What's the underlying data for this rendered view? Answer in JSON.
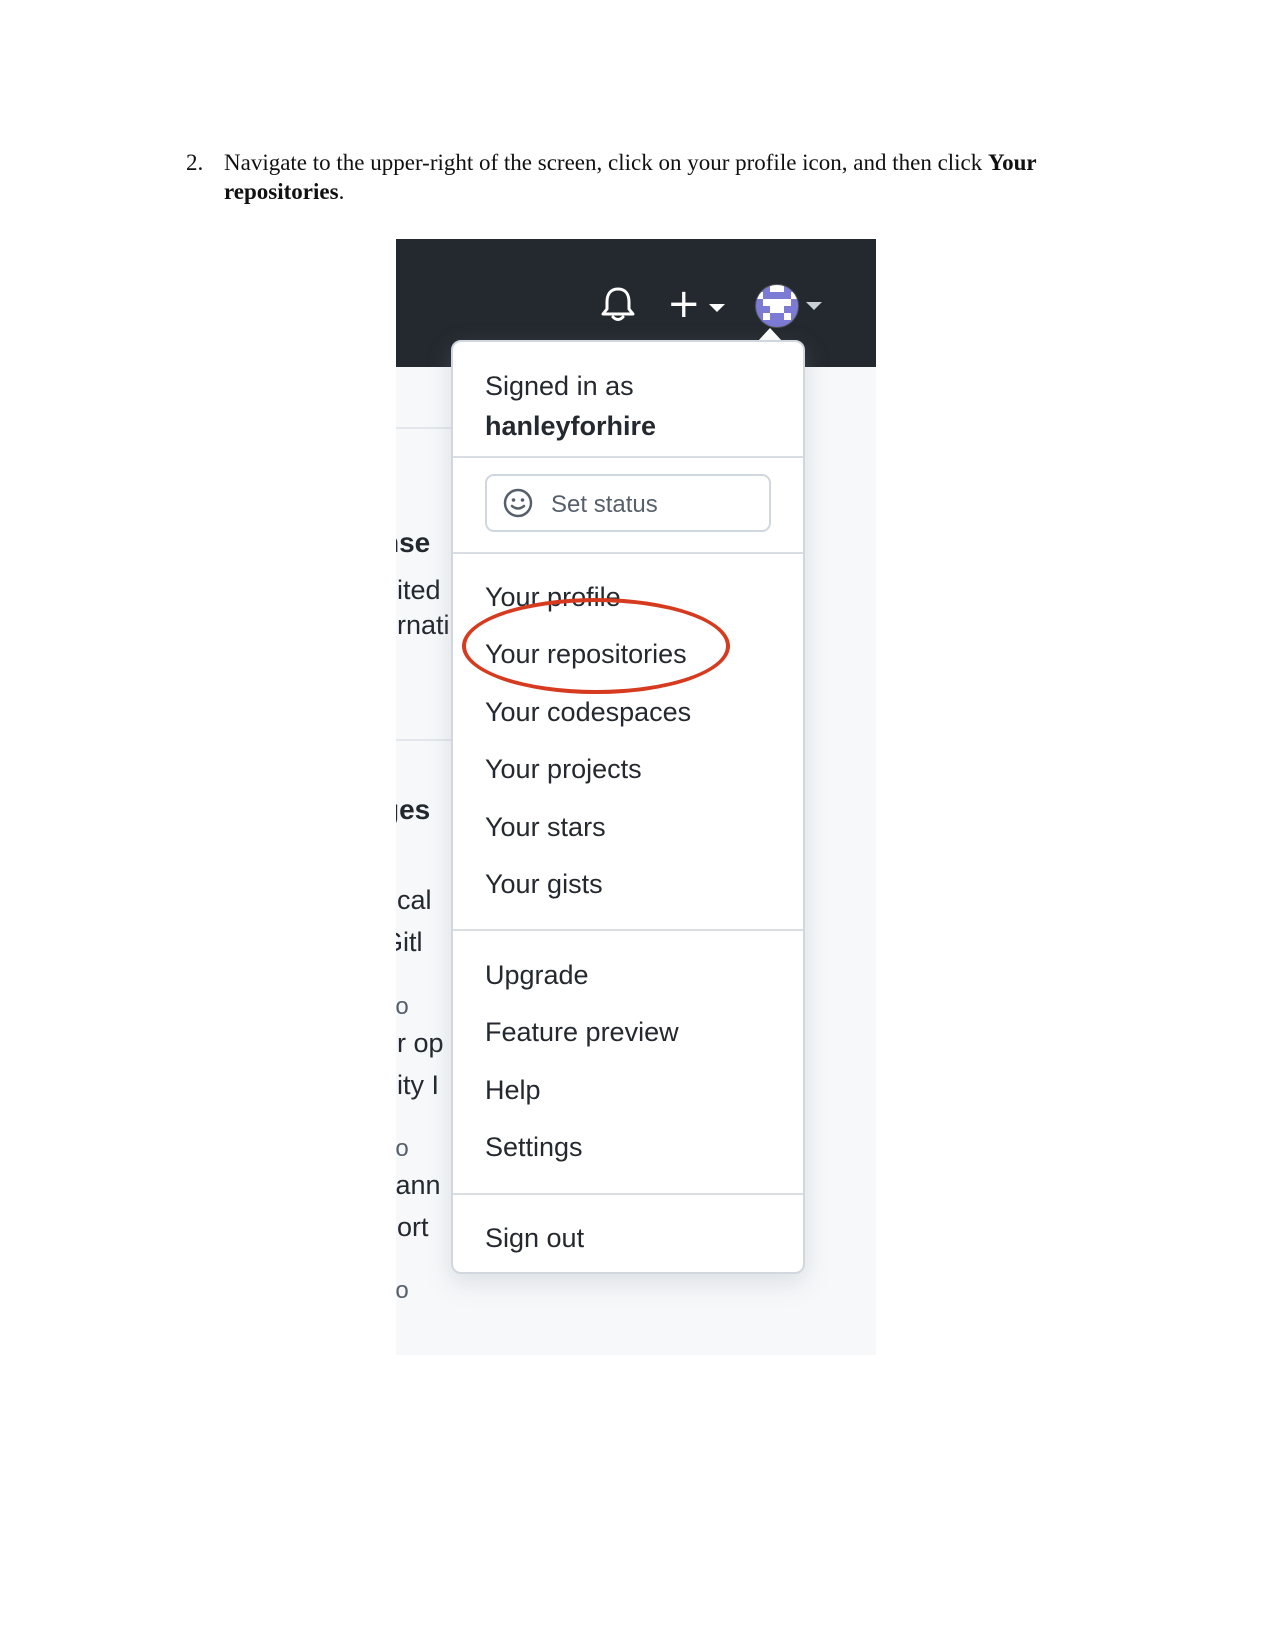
{
  "instruction": {
    "number": "2.",
    "text_before": "Navigate to the upper-right of the screen, click on your profile icon, and then click ",
    "bold_text": "Your repositories",
    "text_after": "."
  },
  "header": {
    "icons": [
      "bell-icon",
      "plus-icon",
      "chevron-down-icon",
      "avatar",
      "chevron-down-icon"
    ]
  },
  "background_fragments": [
    "nse",
    "nited",
    "ernati",
    "ges",
    "o",
    "rical",
    "Gitl",
    "go",
    "ur op",
    "nity I",
    "go",
    "cann",
    "port",
    "go"
  ],
  "menu": {
    "signed_in_label": "Signed in as",
    "username": "hanleyforhire",
    "set_status": "Set status",
    "items": [
      "Your profile",
      "Your repositories",
      "Your codespaces",
      "Your projects",
      "Your stars",
      "Your gists"
    ],
    "secondary": [
      "Upgrade",
      "Feature preview",
      "Help",
      "Settings"
    ],
    "sign_out": "Sign out"
  },
  "highlight": {
    "target": "Your repositories",
    "color": "#d63a1f"
  }
}
